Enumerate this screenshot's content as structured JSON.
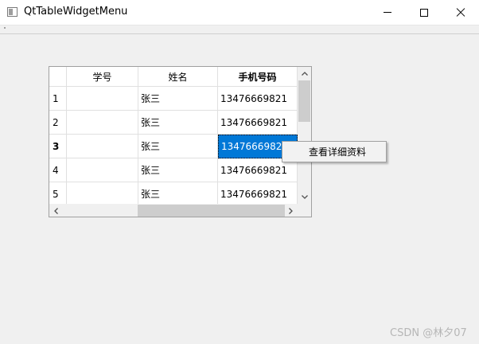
{
  "window": {
    "title": "QtTableWidgetMenu",
    "icon": "app-window-icon",
    "controls": {
      "minimize": "minimize-icon",
      "maximize": "maximize-icon",
      "close": "close-icon"
    }
  },
  "table": {
    "headers": [
      "学号",
      "姓名",
      "手机号码"
    ],
    "bold_header_index": 2,
    "rows": [
      {
        "num": "1",
        "cells": [
          "",
          "张三",
          "13476669821"
        ]
      },
      {
        "num": "2",
        "cells": [
          "",
          "张三",
          "13476669821"
        ]
      },
      {
        "num": "3",
        "cells": [
          "",
          "张三",
          "13476669821"
        ]
      },
      {
        "num": "4",
        "cells": [
          "",
          "张三",
          "13476669821"
        ]
      },
      {
        "num": "5",
        "cells": [
          "",
          "张三",
          "13476669821"
        ]
      }
    ],
    "selected": {
      "row": 2,
      "col": 2
    },
    "selection_color": "#0078d7"
  },
  "context_menu": {
    "items": [
      "查看详细资料"
    ]
  },
  "watermark": "CSDN @林夕07"
}
